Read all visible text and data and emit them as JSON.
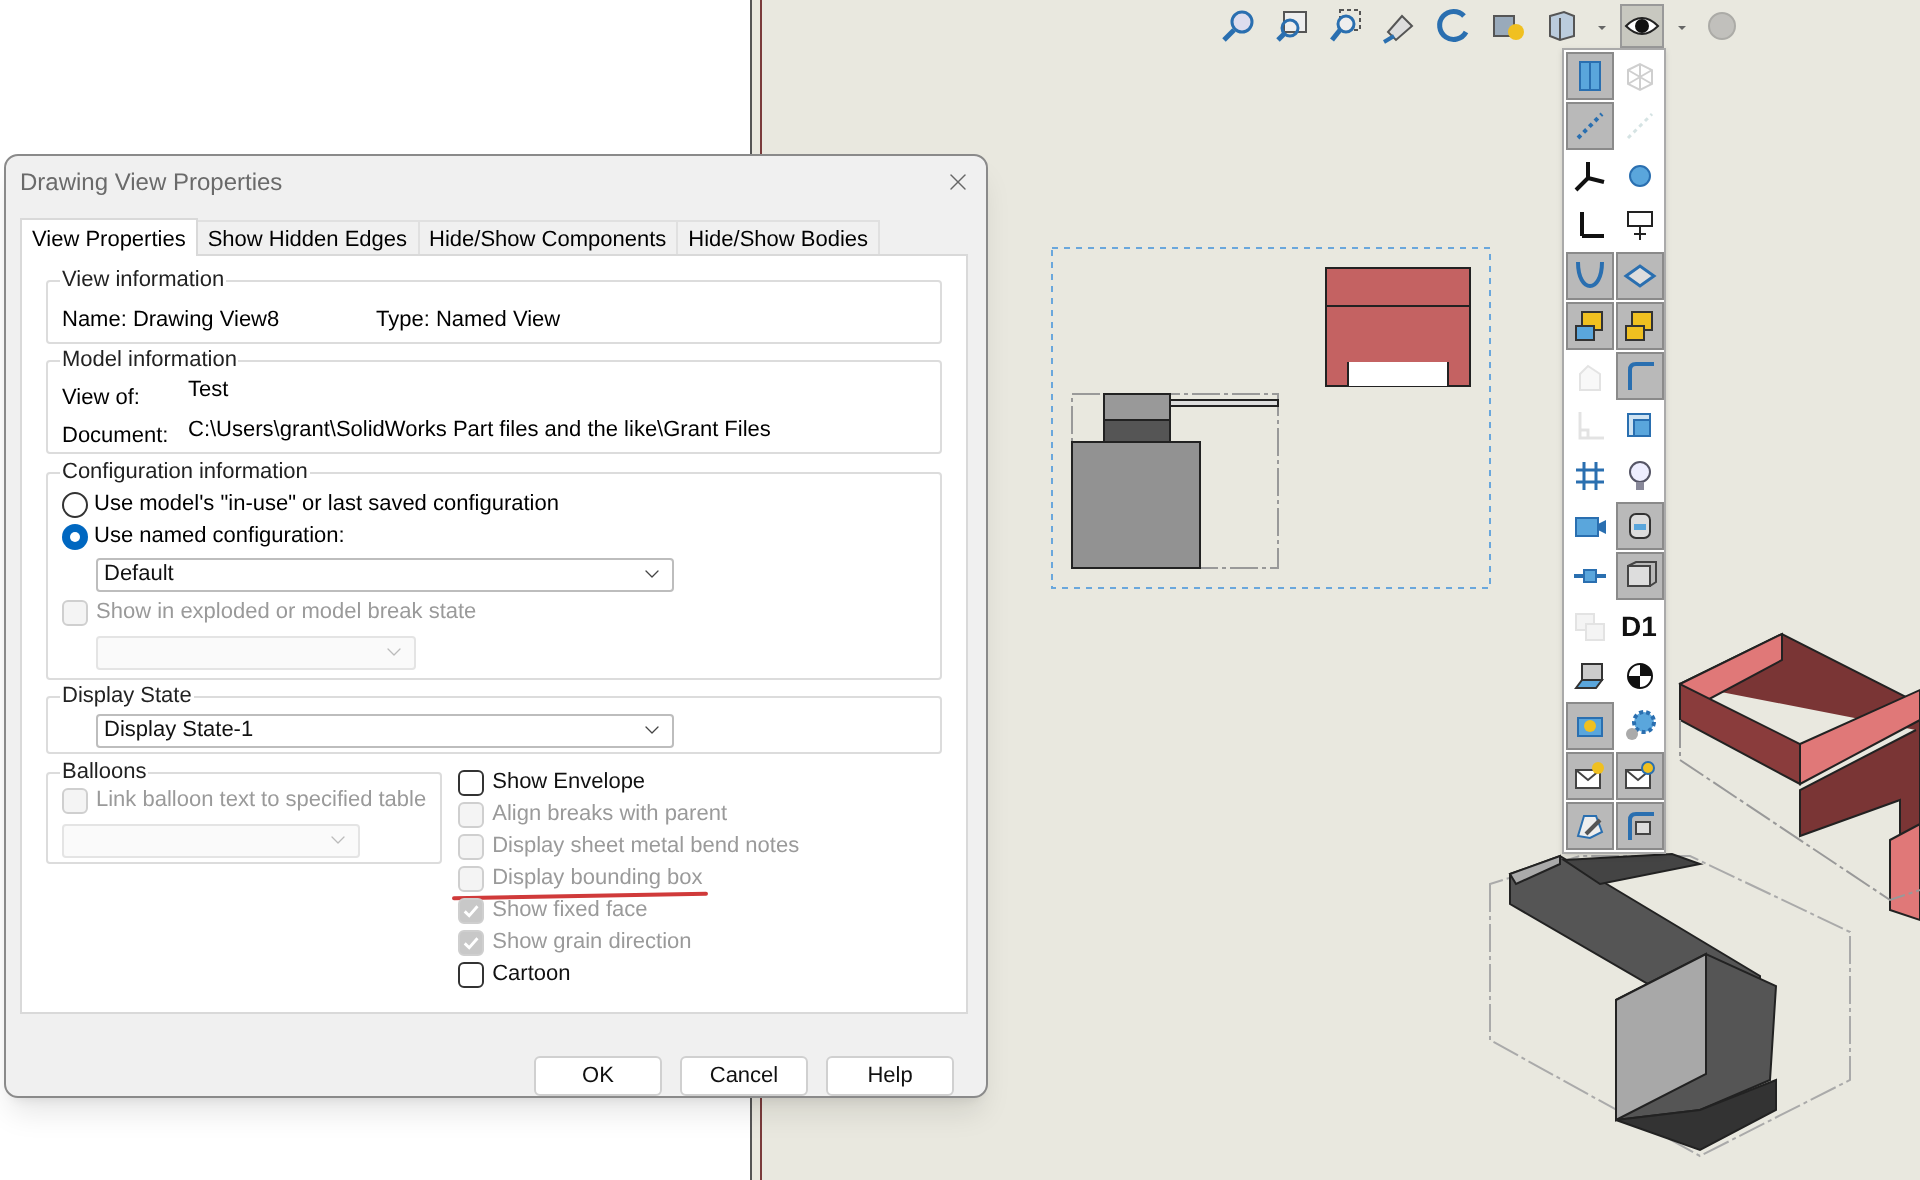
{
  "view_toolbar": [
    {
      "selected": false,
      "disabled": false
    },
    {
      "selected": false,
      "disabled": false
    },
    {
      "selected": false,
      "disabled": false
    },
    {
      "selected": false,
      "disabled": false
    },
    {
      "selected": false,
      "disabled": false
    },
    {
      "selected": false,
      "disabled": false
    },
    {
      "selected": false,
      "disabled": false
    },
    {
      "selected": true,
      "disabled": false
    },
    {
      "selected": false,
      "disabled": true
    }
  ],
  "flyout_toolbar": [
    {
      "kind": "icon",
      "selected": true,
      "disabled": false
    },
    {
      "kind": "icon",
      "selected": false,
      "disabled": true
    },
    {
      "kind": "icon",
      "selected": true,
      "disabled": false
    },
    {
      "kind": "icon",
      "selected": false,
      "disabled": true
    },
    {
      "kind": "icon",
      "selected": false,
      "disabled": false
    },
    {
      "kind": "icon",
      "selected": false,
      "disabled": false
    },
    {
      "kind": "icon",
      "selected": false,
      "disabled": false
    },
    {
      "kind": "icon",
      "selected": false,
      "disabled": false
    },
    {
      "kind": "icon",
      "selected": true,
      "disabled": false
    },
    {
      "kind": "icon",
      "selected": true,
      "disabled": false
    },
    {
      "kind": "icon",
      "selected": true,
      "disabled": false
    },
    {
      "kind": "icon",
      "selected": true,
      "disabled": false
    },
    {
      "kind": "icon",
      "selected": false,
      "disabled": true
    },
    {
      "kind": "icon",
      "selected": true,
      "disabled": false
    },
    {
      "kind": "icon",
      "selected": false,
      "disabled": true
    },
    {
      "kind": "icon",
      "selected": false,
      "disabled": false
    },
    {
      "kind": "icon",
      "selected": false,
      "disabled": false
    },
    {
      "kind": "icon",
      "selected": false,
      "disabled": false
    },
    {
      "kind": "icon",
      "selected": false,
      "disabled": false
    },
    {
      "kind": "icon",
      "selected": true,
      "disabled": false
    },
    {
      "kind": "icon",
      "selected": false,
      "disabled": false
    },
    {
      "kind": "icon",
      "selected": true,
      "disabled": false
    },
    {
      "kind": "icon",
      "selected": false,
      "disabled": true
    },
    {
      "kind": "text",
      "label": "D1",
      "selected": false,
      "disabled": false
    },
    {
      "kind": "icon",
      "selected": false,
      "disabled": false
    },
    {
      "kind": "icon",
      "selected": false,
      "disabled": false
    },
    {
      "kind": "icon",
      "selected": true,
      "disabled": false
    },
    {
      "kind": "icon",
      "selected": false,
      "disabled": false
    },
    {
      "kind": "icon",
      "selected": true,
      "disabled": false
    },
    {
      "kind": "icon",
      "selected": true,
      "disabled": false
    },
    {
      "kind": "icon",
      "selected": true,
      "disabled": false
    },
    {
      "kind": "icon",
      "selected": true,
      "disabled": false
    }
  ],
  "dialog": {
    "title": "Drawing View Properties",
    "tabs": [
      {
        "label": "View Properties",
        "selected": true
      },
      {
        "label": "Show Hidden Edges",
        "selected": false
      },
      {
        "label": "Hide/Show Components",
        "selected": false
      },
      {
        "label": "Hide/Show Bodies",
        "selected": false
      }
    ],
    "view_information": {
      "heading": "View information",
      "name": "Name: Drawing View8",
      "type": "Type: Named View"
    },
    "model_information": {
      "heading": "Model information",
      "fields": [
        {
          "label": "View of:",
          "value": "Test"
        },
        {
          "label": "Document:",
          "value": "C:\\Users\\grant\\SolidWorks Part files and the like\\Grant Files"
        }
      ]
    },
    "configuration_information": {
      "heading": "Configuration information",
      "options": [
        {
          "label": "Use model's \"in-use\" or last saved configuration",
          "selected": false
        },
        {
          "label": "Use named configuration:",
          "selected": true
        }
      ],
      "named_configuration": {
        "value": "Default",
        "disabled": false
      },
      "exploded_state": {
        "label": "Show in exploded or model break state",
        "checked": false,
        "disabled": true
      },
      "exploded_configuration": {
        "disabled": true
      }
    },
    "display_state": {
      "heading": "Display State",
      "dropdown": {
        "value": "Display State-1",
        "disabled": false
      }
    },
    "balloons": {
      "heading": "Balloons",
      "link_option": {
        "label": "Link balloon text to specified table",
        "checked": false,
        "disabled": true
      },
      "table_dropdown": {
        "disabled": true
      }
    },
    "display_options": [
      {
        "label": "Show Envelope",
        "checked": false,
        "disabled": false,
        "underlined": false
      },
      {
        "label": "Align breaks with parent",
        "checked": false,
        "disabled": true,
        "underlined": false
      },
      {
        "label": "Display sheet metal bend notes",
        "checked": false,
        "disabled": true,
        "underlined": false
      },
      {
        "label": "Display bounding box",
        "checked": false,
        "disabled": true,
        "underlined": true
      },
      {
        "label": "Show fixed face",
        "checked": true,
        "disabled": true,
        "underlined": false
      },
      {
        "label": "Show grain direction",
        "checked": true,
        "disabled": true,
        "underlined": false
      },
      {
        "label": "Cartoon",
        "checked": false,
        "disabled": false,
        "underlined": false
      }
    ],
    "buttons": [
      "OK",
      "Cancel",
      "Help"
    ]
  }
}
